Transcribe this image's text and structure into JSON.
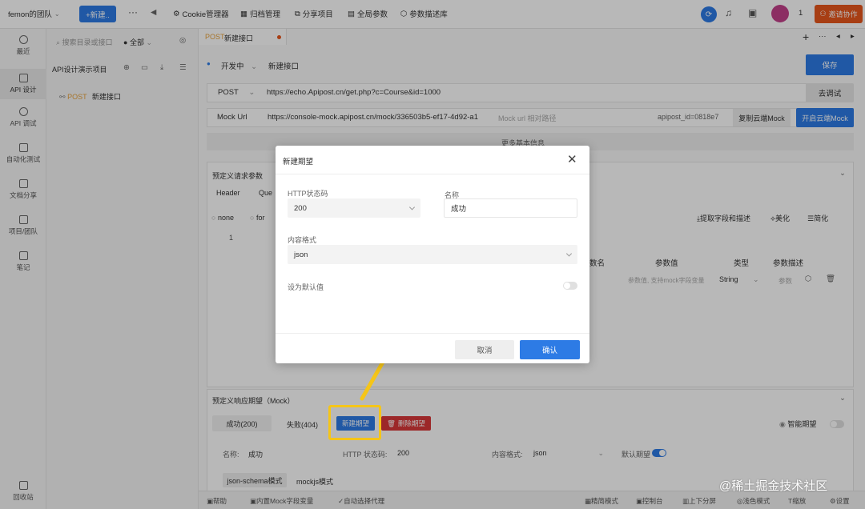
{
  "topbar": {
    "team": "femon的团队",
    "new_button": "+新建..",
    "more": "···",
    "back": "◀",
    "menu": [
      "Cookie管理器",
      "归档管理",
      "分享项目",
      "全局参数",
      "参数描述库"
    ],
    "user_count": "1",
    "invite": "邀请协作"
  },
  "leftnav": {
    "items": [
      {
        "label": "最近",
        "icon": "clock-icon"
      },
      {
        "label": "API 设计",
        "icon": "design-icon"
      },
      {
        "label": "API 调试",
        "icon": "debug-icon"
      },
      {
        "label": "自动化测试",
        "icon": "automation-icon"
      },
      {
        "label": "文档分享",
        "icon": "share-icon"
      },
      {
        "label": "项目/团队",
        "icon": "project-icon"
      },
      {
        "label": "笔记",
        "icon": "note-icon"
      }
    ],
    "trash": "回收站"
  },
  "tree": {
    "search_placeholder": "搜索目录或接口",
    "filter": "全部",
    "project": "API设计演示项目",
    "node_method": "POST",
    "node_name": "新建接口"
  },
  "main": {
    "tab_method": "POST",
    "tab_name": "新建接口",
    "status": "开发中",
    "api_name": "新建接口",
    "save": "保存",
    "method": "POST",
    "url": "https://echo.Apipost.cn/get.php?c=Course&id=1000",
    "debug": "去调试",
    "mock_label": "Mock Url",
    "mock_url": "https://console-mock.apipost.cn/mock/336503b5-ef17-4d92-a1",
    "mock_relative": "Mock url 相对路径",
    "apipost_id": "apipost_id=0818e7",
    "copy_mock": "复制云端Mock",
    "open_mock": "开启云端Mock",
    "more_info": "更多基本信息",
    "request_title": "预定义请求参数",
    "req_tabs": [
      "Header",
      "Que"
    ],
    "radio_none": "none",
    "radio_form": "for",
    "line_no": "1",
    "extract": "提取字段和描述",
    "beautify": "美化",
    "simplify": "简化",
    "cols": [
      "数名",
      "参数值",
      "类型",
      "参数描述"
    ],
    "row_placeholder": "参数值, 支持mock字段变量",
    "row_type": "String",
    "row_desc": "参数",
    "response_title": "预定义响应期望（Mock）",
    "resp_tabs": [
      "成功(200)",
      "失败(404)"
    ],
    "new_expect": "新建期望",
    "delete_expect": "删除期望",
    "smart_expect": "智能期望",
    "name_label": "名称:",
    "name_value": "成功",
    "http_label": "HTTP 状态码:",
    "http_value": "200",
    "format_label": "内容格式:",
    "format_value": "json",
    "default_label": "默认期望",
    "mode_tabs": [
      "json-schema模式",
      "mockjs模式"
    ]
  },
  "dialog": {
    "title": "新建期望",
    "http_label": "HTTP状态码",
    "http_value": "200",
    "name_label": "名称",
    "name_value": "成功",
    "format_label": "内容格式",
    "format_value": "json",
    "default_label": "设为默认值",
    "cancel": "取消",
    "confirm": "确认"
  },
  "bottombar": {
    "left": [
      "帮助",
      "内置Mock字段变量",
      "自动选择代理"
    ],
    "right": [
      "精简模式",
      "控制台",
      "上下分屏",
      "浅色模式",
      "缩放",
      "设置"
    ]
  },
  "watermark": "@稀土掘金技术社区",
  "colors": {
    "primary": "#2d7be5",
    "accent": "#e8561d",
    "highlight": "#f5c518",
    "danger": "#d9383a"
  }
}
